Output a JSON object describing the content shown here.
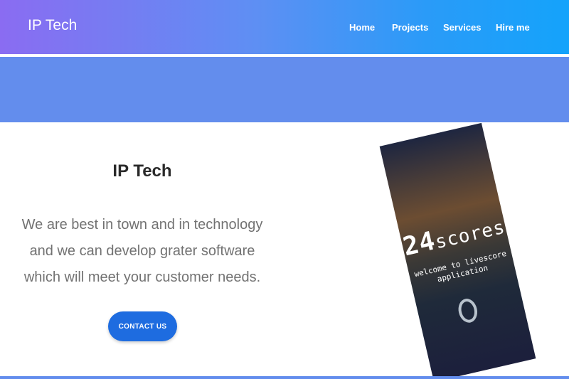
{
  "navbar": {
    "brand": "IP Tech",
    "links": [
      {
        "label": "Home"
      },
      {
        "label": "Projects"
      },
      {
        "label": "Services"
      },
      {
        "label": "Hire me"
      }
    ]
  },
  "hero": {
    "title": "IP Tech",
    "text_lines": [
      "We are best in town and in technology",
      "and we can develop grater software",
      "which will meet your customer needs."
    ],
    "contact_label": "CONTACT US"
  },
  "phone": {
    "logo_number": "24",
    "logo_word": "scores",
    "subtitle_line1": "welcome to livescore",
    "subtitle_line2": "application"
  },
  "colors": {
    "nav_gradient_start": "#8a6cf2",
    "nav_gradient_end": "#14a3fb",
    "band": "#638ded",
    "button": "#1e6ce0"
  }
}
